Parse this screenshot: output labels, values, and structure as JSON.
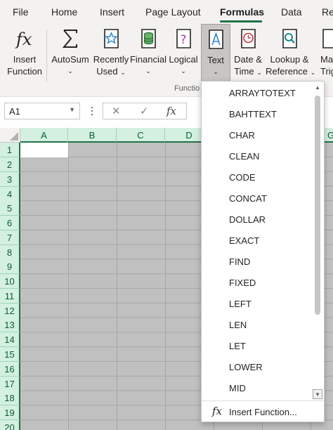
{
  "tabs": [
    "File",
    "Home",
    "Insert",
    "Page Layout",
    "Formulas",
    "Data",
    "Re"
  ],
  "active_tab": "Formulas",
  "ribbon": {
    "insert_function": [
      "Insert",
      "Function"
    ],
    "autosum": "AutoSum",
    "recently_used": [
      "Recently",
      "Used"
    ],
    "financial": "Financial",
    "logical": "Logical",
    "text": "Text",
    "date_time": [
      "Date &",
      "Time"
    ],
    "lookup_reference": [
      "Lookup &",
      "Reference"
    ],
    "math_trig": [
      "Mat",
      "Trig"
    ],
    "group_label": "Functio"
  },
  "formula_bar": {
    "name_box": "A1",
    "cancel_glyph": "✕",
    "enter_glyph": "✓",
    "fx_glyph": "fx"
  },
  "grid": {
    "columns": [
      "A",
      "B",
      "C",
      "D",
      "",
      "G"
    ],
    "rows": [
      "1",
      "2",
      "3",
      "4",
      "5",
      "6",
      "7",
      "8",
      "9",
      "10",
      "11",
      "12",
      "13",
      "14",
      "15",
      "16",
      "17",
      "18",
      "19",
      "20"
    ]
  },
  "text_menu": {
    "items": [
      "ARRAYTOTEXT",
      "BAHTTEXT",
      "CHAR",
      "CLEAN",
      "CODE",
      "CONCAT",
      "DOLLAR",
      "EXACT",
      "FIND",
      "FIXED",
      "LEFT",
      "LEN",
      "LET",
      "LOWER",
      "MID"
    ],
    "footer_icon": "fx",
    "footer_label": "Insert Function..."
  },
  "colors": {
    "accent": "#217346",
    "header_selected": "#d3f0e0",
    "selection_fill": "#c0c0c0"
  }
}
